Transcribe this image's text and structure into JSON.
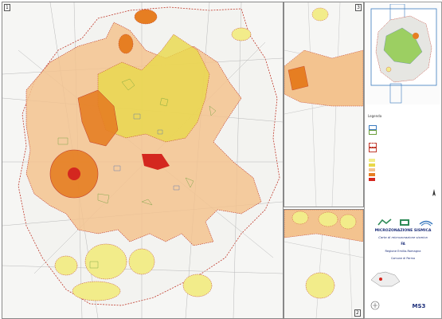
{
  "frames": {
    "main_number": "1",
    "inset1_number": "3",
    "inset2_number": "2"
  },
  "legend": {
    "title": "Legenda"
  },
  "title_block": {
    "title": "MICROZONAZIONE SISMICA",
    "subtitle": "Carta di microzonazione sismica",
    "code": "FA",
    "scale_note": "",
    "region": "Regione Emilia-Romagna",
    "municipality": "Comune di Parma",
    "sheet_code": "MS3"
  },
  "colors": {
    "zone_light_yellow": "#f2ec8a",
    "zone_yellow": "#e8d84a",
    "zone_peach": "#f3c38f",
    "zone_orange": "#e67e22",
    "zone_red": "#d4271f",
    "border_red": "#c0392b",
    "road_gray": "#b8b8b8",
    "title_blue": "#1d2f7a"
  }
}
